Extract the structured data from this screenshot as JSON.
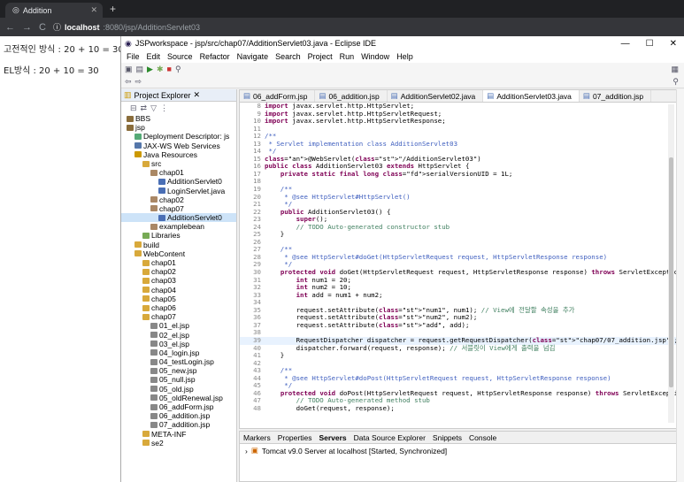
{
  "browser": {
    "tab_title": "Addition",
    "url_host": "localhost",
    "url_path": ":8080/jsp/AdditionServlet03"
  },
  "page": {
    "lines": [
      "고전적인 방식 : 20 + 10 = 30",
      "EL방식 : 20 + 10 = 30"
    ]
  },
  "eclipse": {
    "title": "JSPworkspace - jsp/src/chap07/AdditionServlet03.java - Eclipse IDE",
    "menu": [
      "File",
      "Edit",
      "Source",
      "Refactor",
      "Navigate",
      "Search",
      "Project",
      "Run",
      "Window",
      "Help"
    ],
    "project_explorer": {
      "title": "Project Explorer",
      "tree": [
        {
          "label": "BBS",
          "depth": 0,
          "kind": "project"
        },
        {
          "label": "jsp",
          "depth": 0,
          "kind": "project"
        },
        {
          "label": "Deployment Descriptor: js",
          "depth": 1,
          "kind": "dd"
        },
        {
          "label": "JAX-WS Web Services",
          "depth": 1,
          "kind": "ws"
        },
        {
          "label": "Java Resources",
          "depth": 1,
          "kind": "jr"
        },
        {
          "label": "src",
          "depth": 2,
          "kind": "folder"
        },
        {
          "label": "chap01",
          "depth": 3,
          "kind": "pkg"
        },
        {
          "label": "AdditionServlet0",
          "depth": 4,
          "kind": "java"
        },
        {
          "label": "LoginServlet.java",
          "depth": 4,
          "kind": "java"
        },
        {
          "label": "chap02",
          "depth": 3,
          "kind": "pkg"
        },
        {
          "label": "chap07",
          "depth": 3,
          "kind": "pkg"
        },
        {
          "label": "AdditionServlet0",
          "depth": 4,
          "kind": "java",
          "selected": true
        },
        {
          "label": "examplebean",
          "depth": 3,
          "kind": "pkg"
        },
        {
          "label": "Libraries",
          "depth": 2,
          "kind": "lib"
        },
        {
          "label": "build",
          "depth": 1,
          "kind": "folder"
        },
        {
          "label": "WebContent",
          "depth": 1,
          "kind": "folder"
        },
        {
          "label": "chap01",
          "depth": 2,
          "kind": "folder"
        },
        {
          "label": "chap02",
          "depth": 2,
          "kind": "folder"
        },
        {
          "label": "chap03",
          "depth": 2,
          "kind": "folder"
        },
        {
          "label": "chap04",
          "depth": 2,
          "kind": "folder"
        },
        {
          "label": "chap05",
          "depth": 2,
          "kind": "folder"
        },
        {
          "label": "chap06",
          "depth": 2,
          "kind": "folder"
        },
        {
          "label": "chap07",
          "depth": 2,
          "kind": "folder"
        },
        {
          "label": "01_el.jsp",
          "depth": 3,
          "kind": "jsp"
        },
        {
          "label": "02_el.jsp",
          "depth": 3,
          "kind": "jsp"
        },
        {
          "label": "03_el.jsp",
          "depth": 3,
          "kind": "jsp"
        },
        {
          "label": "04_login.jsp",
          "depth": 3,
          "kind": "jsp"
        },
        {
          "label": "04_testLogin.jsp",
          "depth": 3,
          "kind": "jsp"
        },
        {
          "label": "05_new.jsp",
          "depth": 3,
          "kind": "jsp"
        },
        {
          "label": "05_null.jsp",
          "depth": 3,
          "kind": "jsp"
        },
        {
          "label": "05_old.jsp",
          "depth": 3,
          "kind": "jsp"
        },
        {
          "label": "05_oldRenewal.jsp",
          "depth": 3,
          "kind": "jsp"
        },
        {
          "label": "06_addForm.jsp",
          "depth": 3,
          "kind": "jsp"
        },
        {
          "label": "06_addition.jsp",
          "depth": 3,
          "kind": "jsp"
        },
        {
          "label": "07_addition.jsp",
          "depth": 3,
          "kind": "jsp"
        },
        {
          "label": "META-INF",
          "depth": 2,
          "kind": "folder"
        },
        {
          "label": "se2",
          "depth": 2,
          "kind": "folder"
        }
      ]
    },
    "editor_tabs": [
      {
        "label": "06_addForm.jsp",
        "active": false
      },
      {
        "label": "06_addition.jsp",
        "active": false
      },
      {
        "label": "AdditionServlet02.java",
        "active": false
      },
      {
        "label": "AdditionServlet03.java",
        "active": true
      },
      {
        "label": "07_addition.jsp",
        "active": false
      }
    ],
    "code": [
      {
        "n": "8",
        "t": "import javax.servlet.http.HttpServlet;"
      },
      {
        "n": "9",
        "t": "import javax.servlet.http.HttpServletRequest;"
      },
      {
        "n": "10",
        "t": "import javax.servlet.http.HttpServletResponse;"
      },
      {
        "n": "11",
        "t": ""
      },
      {
        "n": "12",
        "t": "/**"
      },
      {
        "n": "13",
        "t": " * Servlet implementation class AdditionServlet03"
      },
      {
        "n": "14",
        "t": " */"
      },
      {
        "n": "15",
        "t": "@WebServlet(\"/AdditionServlet03\")"
      },
      {
        "n": "16",
        "t": "public class AdditionServlet03 extends HttpServlet {"
      },
      {
        "n": "17",
        "t": "    private static final long serialVersionUID = 1L;"
      },
      {
        "n": "18",
        "t": ""
      },
      {
        "n": "19",
        "t": "    /**"
      },
      {
        "n": "20",
        "t": "     * @see HttpServlet#HttpServlet()"
      },
      {
        "n": "21",
        "t": "     */"
      },
      {
        "n": "22",
        "t": "    public AdditionServlet03() {"
      },
      {
        "n": "23",
        "t": "        super();"
      },
      {
        "n": "24",
        "t": "        // TODO Auto-generated constructor stub"
      },
      {
        "n": "25",
        "t": "    }"
      },
      {
        "n": "26",
        "t": ""
      },
      {
        "n": "27",
        "t": "    /**"
      },
      {
        "n": "28",
        "t": "     * @see HttpServlet#doGet(HttpServletRequest request, HttpServletResponse response)"
      },
      {
        "n": "29",
        "t": "     */"
      },
      {
        "n": "30",
        "t": "    protected void doGet(HttpServletRequest request, HttpServletResponse response) throws ServletExceptio"
      },
      {
        "n": "31",
        "t": "        int num1 = 20;"
      },
      {
        "n": "32",
        "t": "        int num2 = 10;"
      },
      {
        "n": "33",
        "t": "        int add = num1 + num2;"
      },
      {
        "n": "34",
        "t": ""
      },
      {
        "n": "35",
        "t": "        request.setAttribute(\"num1\", num1); // View에 전달할 속성을 추가"
      },
      {
        "n": "36",
        "t": "        request.setAttribute(\"num2\", num2);"
      },
      {
        "n": "37",
        "t": "        request.setAttribute(\"add\", add);"
      },
      {
        "n": "38",
        "t": ""
      },
      {
        "n": "39",
        "t": "        RequestDispatcher dispatcher = request.getRequestDispatcher(\"chap07/07_addition.jsp\");"
      },
      {
        "n": "40",
        "t": "        dispatcher.forward(request, response); // 서블릿이 View에게 출력을 넘김"
      },
      {
        "n": "41",
        "t": "    }"
      },
      {
        "n": "42",
        "t": ""
      },
      {
        "n": "43",
        "t": "    /**"
      },
      {
        "n": "44",
        "t": "     * @see HttpServlet#doPost(HttpServletRequest request, HttpServletResponse response)"
      },
      {
        "n": "45",
        "t": "     */"
      },
      {
        "n": "46",
        "t": "    protected void doPost(HttpServletRequest request, HttpServletResponse response) throws ServletExcepti"
      },
      {
        "n": "47",
        "t": "        // TODO Auto-generated method stub"
      },
      {
        "n": "48",
        "t": "        doGet(request, response);"
      }
    ],
    "bottom_tabs": [
      "Markers",
      "Properties",
      "Servers",
      "Data Source Explorer",
      "Snippets",
      "Console"
    ],
    "server_row": "Tomcat v9.0 Server at localhost  [Started, Synchronized]"
  }
}
